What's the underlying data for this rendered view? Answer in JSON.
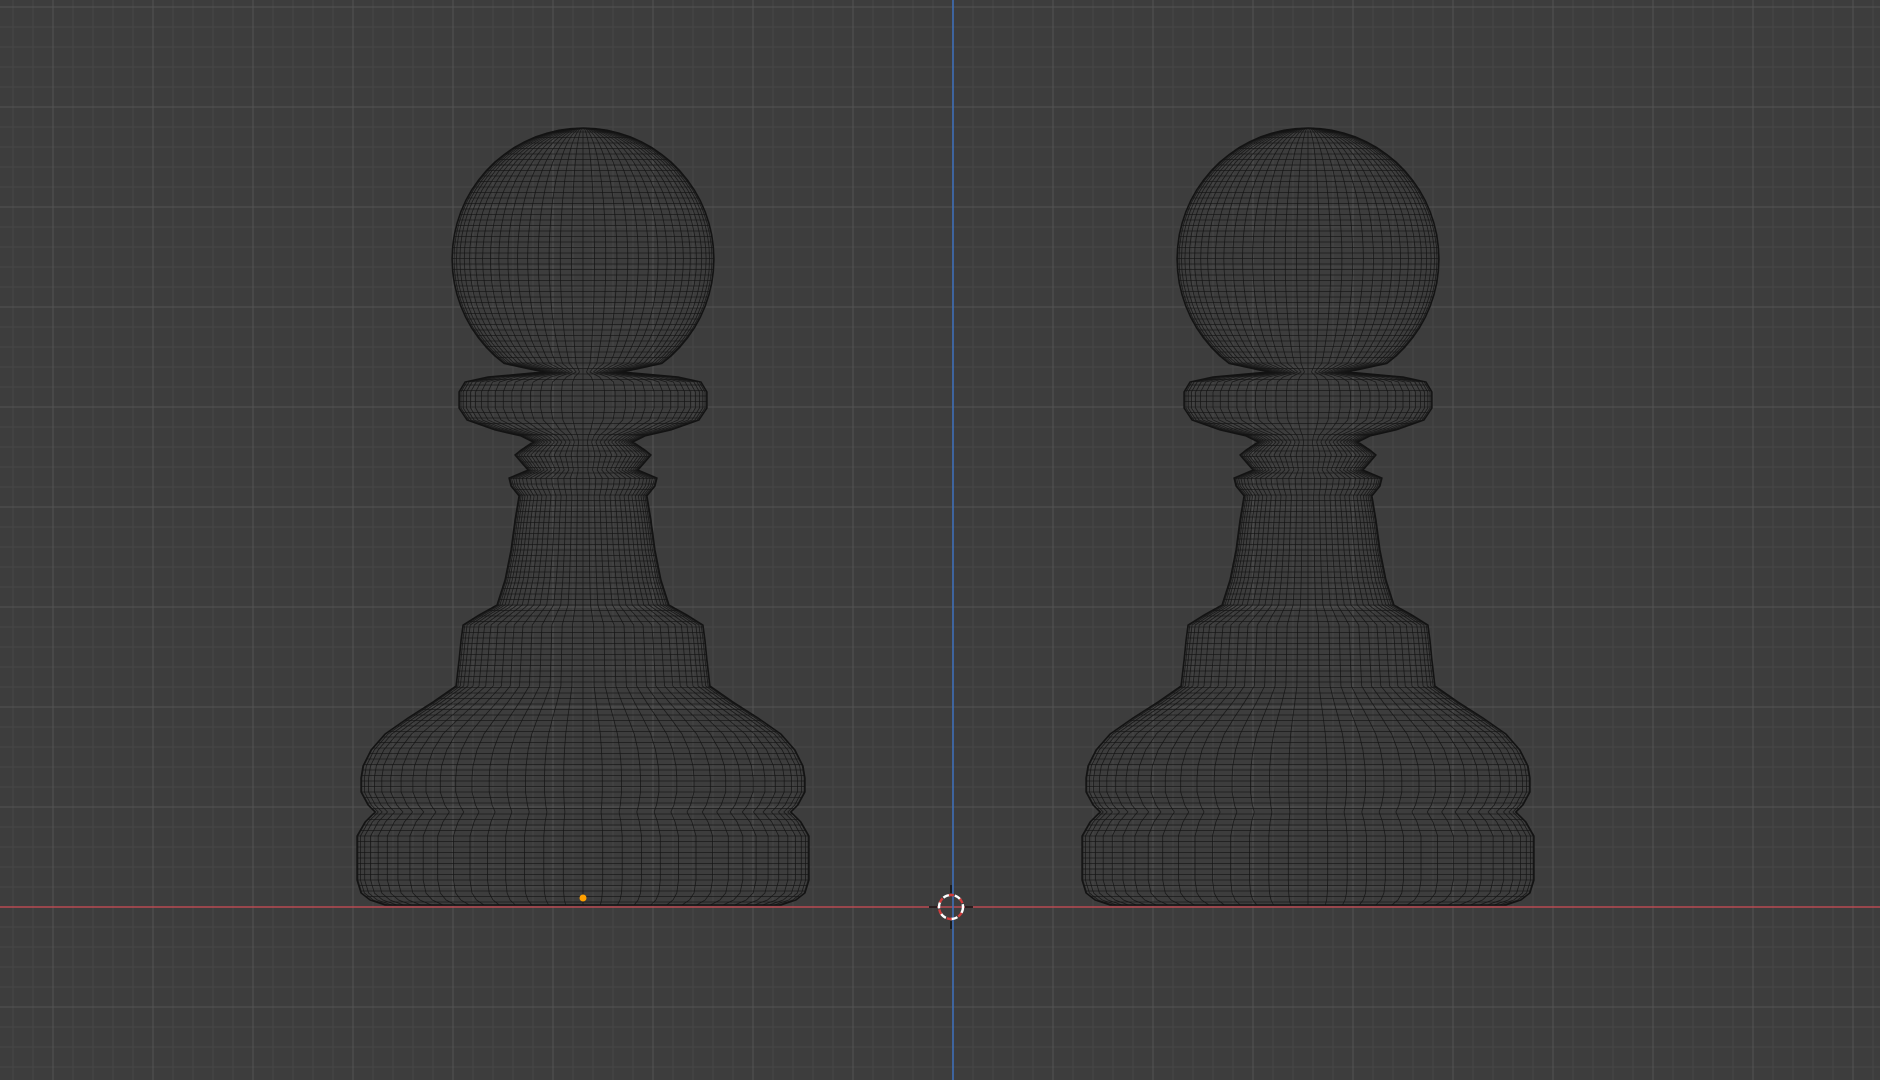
{
  "viewport": {
    "view": "front-orthographic",
    "shading": "wireframe",
    "background_color": "#3d3d3d",
    "minor_grid_color": "#474747",
    "major_grid_color": "#545454",
    "x_axis_color": "#b84a52",
    "z_axis_color": "#3f6fb8",
    "wire_color": "#141414",
    "cursor_color": "#ffffff",
    "cursor_accent_color": "#d23c3c",
    "origin_marker_color": "#ffa000"
  },
  "objects": [
    {
      "name": "pawn-left",
      "icon": "pawn-mesh",
      "selected": false,
      "has_origin_marker": true
    },
    {
      "name": "pawn-right",
      "icon": "pawn-mesh",
      "selected": false,
      "has_origin_marker": false
    }
  ],
  "cursor": {
    "icon": "3d-cursor-icon"
  }
}
